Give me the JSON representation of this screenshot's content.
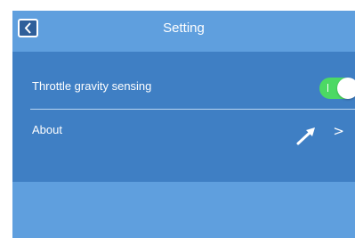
{
  "header": {
    "title": "Setting",
    "back_icon": "chevron-left-icon"
  },
  "settings": {
    "throttle_label": "Throttle gravity sensing",
    "throttle_enabled": true,
    "about_label": "About",
    "about_chevron": ">"
  },
  "colors": {
    "header_bg": "#5f9fde",
    "content_bg": "#3f7fc4",
    "toggle_on": "#4cd964"
  }
}
